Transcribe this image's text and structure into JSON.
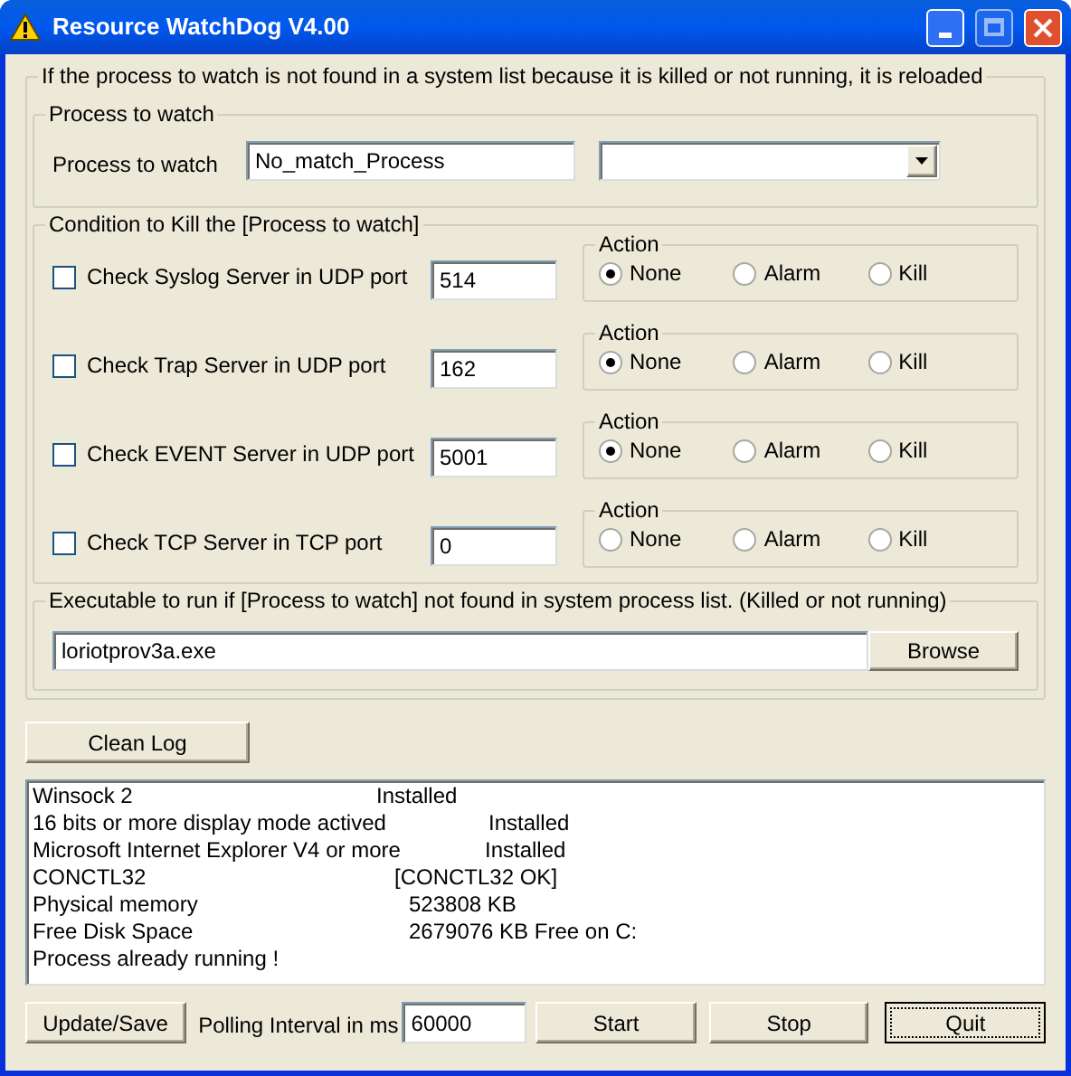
{
  "window": {
    "title": "Resource WatchDog V4.00"
  },
  "main_group": {
    "title": "If the process to watch is not found in a system list because it is killed or not running, it is reloaded"
  },
  "process_group": {
    "title": "Process to watch",
    "label": "Process to watch",
    "value": "No_match_Process"
  },
  "condition_group": {
    "title": "Condition to Kill the [Process to watch]",
    "conditions": [
      {
        "label": "Check Syslog Server in UDP port",
        "checked": false,
        "port": "514",
        "action_title": "Action",
        "actions": [
          {
            "label": "None",
            "selected": true
          },
          {
            "label": "Alarm",
            "selected": false
          },
          {
            "label": "Kill",
            "selected": false
          }
        ]
      },
      {
        "label": "Check Trap Server in UDP port",
        "checked": false,
        "port": "162",
        "action_title": "Action",
        "actions": [
          {
            "label": "None",
            "selected": true
          },
          {
            "label": "Alarm",
            "selected": false
          },
          {
            "label": "Kill",
            "selected": false
          }
        ]
      },
      {
        "label": "Check EVENT Server in UDP port",
        "checked": false,
        "port": "5001",
        "action_title": "Action",
        "actions": [
          {
            "label": "None",
            "selected": true
          },
          {
            "label": "Alarm",
            "selected": false
          },
          {
            "label": "Kill",
            "selected": false
          }
        ]
      },
      {
        "label": "Check TCP Server in TCP port",
        "checked": false,
        "port": "0",
        "action_title": "Action",
        "actions": [
          {
            "label": "None",
            "selected": false
          },
          {
            "label": "Alarm",
            "selected": false
          },
          {
            "label": "Kill",
            "selected": false
          }
        ]
      }
    ]
  },
  "exec_group": {
    "title": "Executable to run if [Process to watch] not found in system process list. (Killed or not running)",
    "value": "loriotprov3a.exe",
    "browse": "Browse"
  },
  "clean_log": "Clean Log",
  "log": [
    {
      "name": "Winsock 2",
      "value": "Installed"
    },
    {
      "name": "16 bits or more display mode actived",
      "value": "Installed"
    },
    {
      "name": "Microsoft Internet Explorer V4 or more",
      "value": "Installed"
    },
    {
      "name": "CONCTL32",
      "value": "[CONCTL32  OK]"
    },
    {
      "name": "Physical memory",
      "value": "523808 KB"
    },
    {
      "name": "Free Disk Space",
      "value": "2679076 KB Free on C:"
    },
    {
      "name": "Process already running !"
    }
  ],
  "bottom": {
    "update": "Update/Save",
    "interval_label": "Polling Interval in ms",
    "interval": "60000",
    "start": "Start",
    "stop": "Stop",
    "quit": "Quit"
  }
}
